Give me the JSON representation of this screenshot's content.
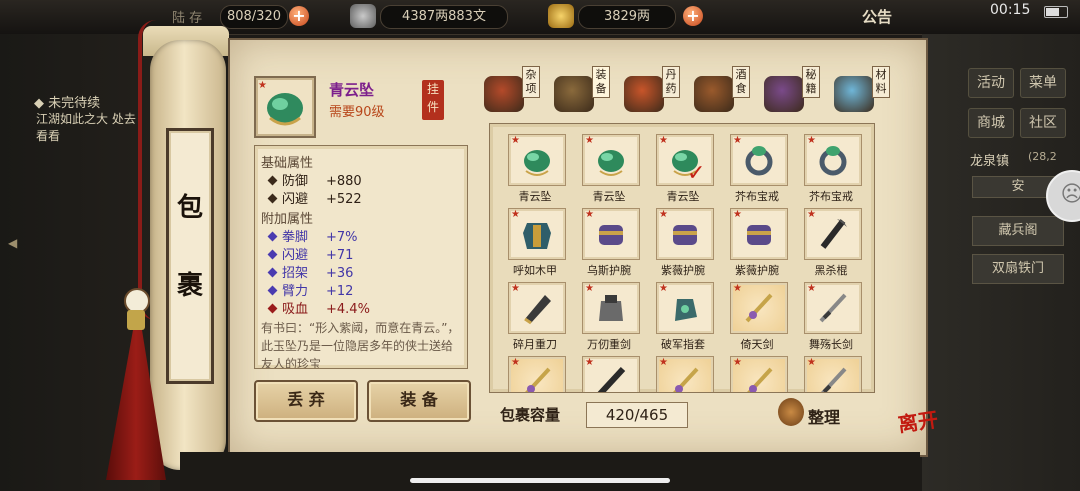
{
  "status_bar": {
    "clock": "00:15",
    "top_left_partial": "陆 存",
    "storage": "808/320",
    "silver": "4387两883文",
    "gold": "3829两",
    "notice": "公告"
  },
  "quest": {
    "title": "未完待续",
    "text": "江湖如此之大 处去看看"
  },
  "side_panel": {
    "buttons": [
      "活动",
      "菜单",
      "商城",
      "社区"
    ],
    "location": "龙泉镇",
    "location_num": "(28,2",
    "location_sub": "安",
    "list_items": [
      "藏兵阁",
      "双扇铁门"
    ]
  },
  "scroll_title": [
    "包",
    "裹"
  ],
  "selected": {
    "name": "青云坠",
    "requirement": "需要90级",
    "seal": [
      "挂",
      "件"
    ],
    "basic_header": "基础属性",
    "basic": [
      {
        "k": "防御",
        "v": "+880"
      },
      {
        "k": "闪避",
        "v": "+522"
      }
    ],
    "extra_header": "附加属性",
    "extra": [
      {
        "k": "拳脚",
        "v": "+7%"
      },
      {
        "k": "闪避",
        "v": "+71"
      },
      {
        "k": "招架",
        "v": "+36"
      },
      {
        "k": "臂力",
        "v": "+12"
      },
      {
        "k": "吸血",
        "v": "+4.4%"
      }
    ],
    "description": "有书曰：“形入紫阈，而意在青云。”，此玉坠乃是一位隐居多年的侠士送给友人的珍宝"
  },
  "actions": {
    "discard": "丢 弃",
    "equip": "装 备"
  },
  "tabs": [
    {
      "label": "杂项",
      "color": "#b44a2a"
    },
    {
      "label": "装备",
      "color": "#8a6a3c"
    },
    {
      "label": "丹药",
      "color": "#c8552a"
    },
    {
      "label": "酒食",
      "color": "#9a5a2c"
    },
    {
      "label": "秘籍",
      "color": "#7a4a8a"
    },
    {
      "label": "材料",
      "color": "#6fb6d8"
    }
  ],
  "items": [
    {
      "name": "青云坠",
      "kind": "jade"
    },
    {
      "name": "青云坠",
      "kind": "jade"
    },
    {
      "name": "青云坠",
      "kind": "jade",
      "checked": true
    },
    {
      "name": "芥布宝戒",
      "kind": "ring"
    },
    {
      "name": "芥布宝戒",
      "kind": "ring"
    },
    {
      "name": "呼如木甲",
      "kind": "armor"
    },
    {
      "name": "乌斯护腕",
      "kind": "bracer"
    },
    {
      "name": "紫薇护腕",
      "kind": "bracer"
    },
    {
      "name": "紫薇护腕",
      "kind": "bracer"
    },
    {
      "name": "黑杀棍",
      "kind": "staff"
    },
    {
      "name": "碎月重刀",
      "kind": "blade"
    },
    {
      "name": "万仞重剑",
      "kind": "gauntlet"
    },
    {
      "name": "破军指套",
      "kind": "glove"
    },
    {
      "name": "倚天剑",
      "kind": "sword",
      "gold": true
    },
    {
      "name": "舞殇长剑",
      "kind": "sword2"
    },
    {
      "name": "",
      "kind": "sword",
      "gold": true
    },
    {
      "name": "",
      "kind": "dark"
    },
    {
      "name": "",
      "kind": "sword",
      "gold": true
    },
    {
      "name": "",
      "kind": "sword",
      "gold": true
    },
    {
      "name": "",
      "kind": "sword2",
      "gold": true
    }
  ],
  "capacity": {
    "label": "包裹容量",
    "value": "420/465"
  },
  "sort_label": "整理",
  "leave_label": "离开",
  "colors": {
    "paper": "#ece0c2",
    "purple_name": "#7c1f8c",
    "req_orange": "#b8461a",
    "extra_blue": "#4236a8",
    "lifesteal_red": "#8a1a1a"
  }
}
